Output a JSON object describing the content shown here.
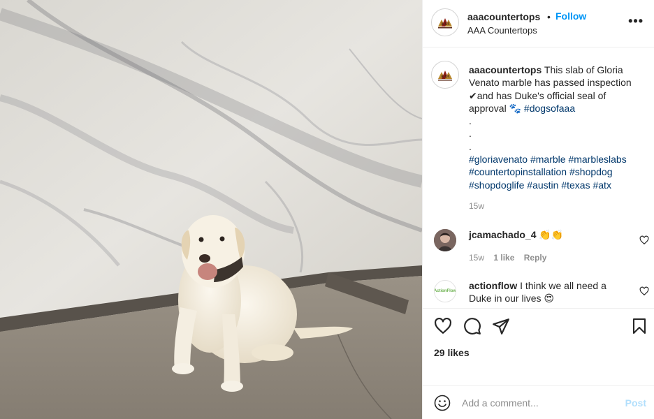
{
  "post": {
    "image_alt": "Yellow labrador sitting in front of a Gloria Venato marble slab",
    "account": {
      "username": "aaacountertops",
      "separator": "•",
      "follow_label": "Follow",
      "full_name": "AAA Countertops",
      "more_label": "•••",
      "avatar_logo_text": "AAA"
    },
    "caption": {
      "username": "aaacountertops",
      "text_part1": " This slab of Gloria Venato marble has passed inspection ✔and has Duke's official seal of approval 🐾 ",
      "hashtag1": "#dogsofaaa",
      "dots": [
        ".",
        ".",
        "."
      ],
      "hashtags": [
        "#gloriavenato",
        "#marble",
        "#marbleslabs",
        "#countertopinstallation",
        "#shopdog",
        "#shopdoglife",
        "#austin",
        "#texas",
        "#atx"
      ],
      "time": "15w"
    },
    "comments": [
      {
        "username": "jcamachado_4",
        "text": " 👏👏",
        "time": "15w",
        "likes": "1 like",
        "reply_label": "Reply"
      },
      {
        "username": "actionflow",
        "text": " I think we all need a Duke in our lives 😍",
        "avatar_text": "ActionFlow"
      }
    ],
    "likes_text": "29 likes",
    "add_comment": {
      "placeholder": "Add a comment...",
      "post_label": "Post"
    },
    "icons": [
      "like-icon",
      "comment-icon",
      "share-icon",
      "save-icon",
      "emoji-icon",
      "more-icon",
      "heart-icon"
    ],
    "colors": {
      "follow_blue": "#0095f6",
      "hashtag_blue": "#00376b",
      "muted_gray": "#8e8e8e",
      "post_disabled": "#b2dffc",
      "border": "#efefef"
    }
  }
}
